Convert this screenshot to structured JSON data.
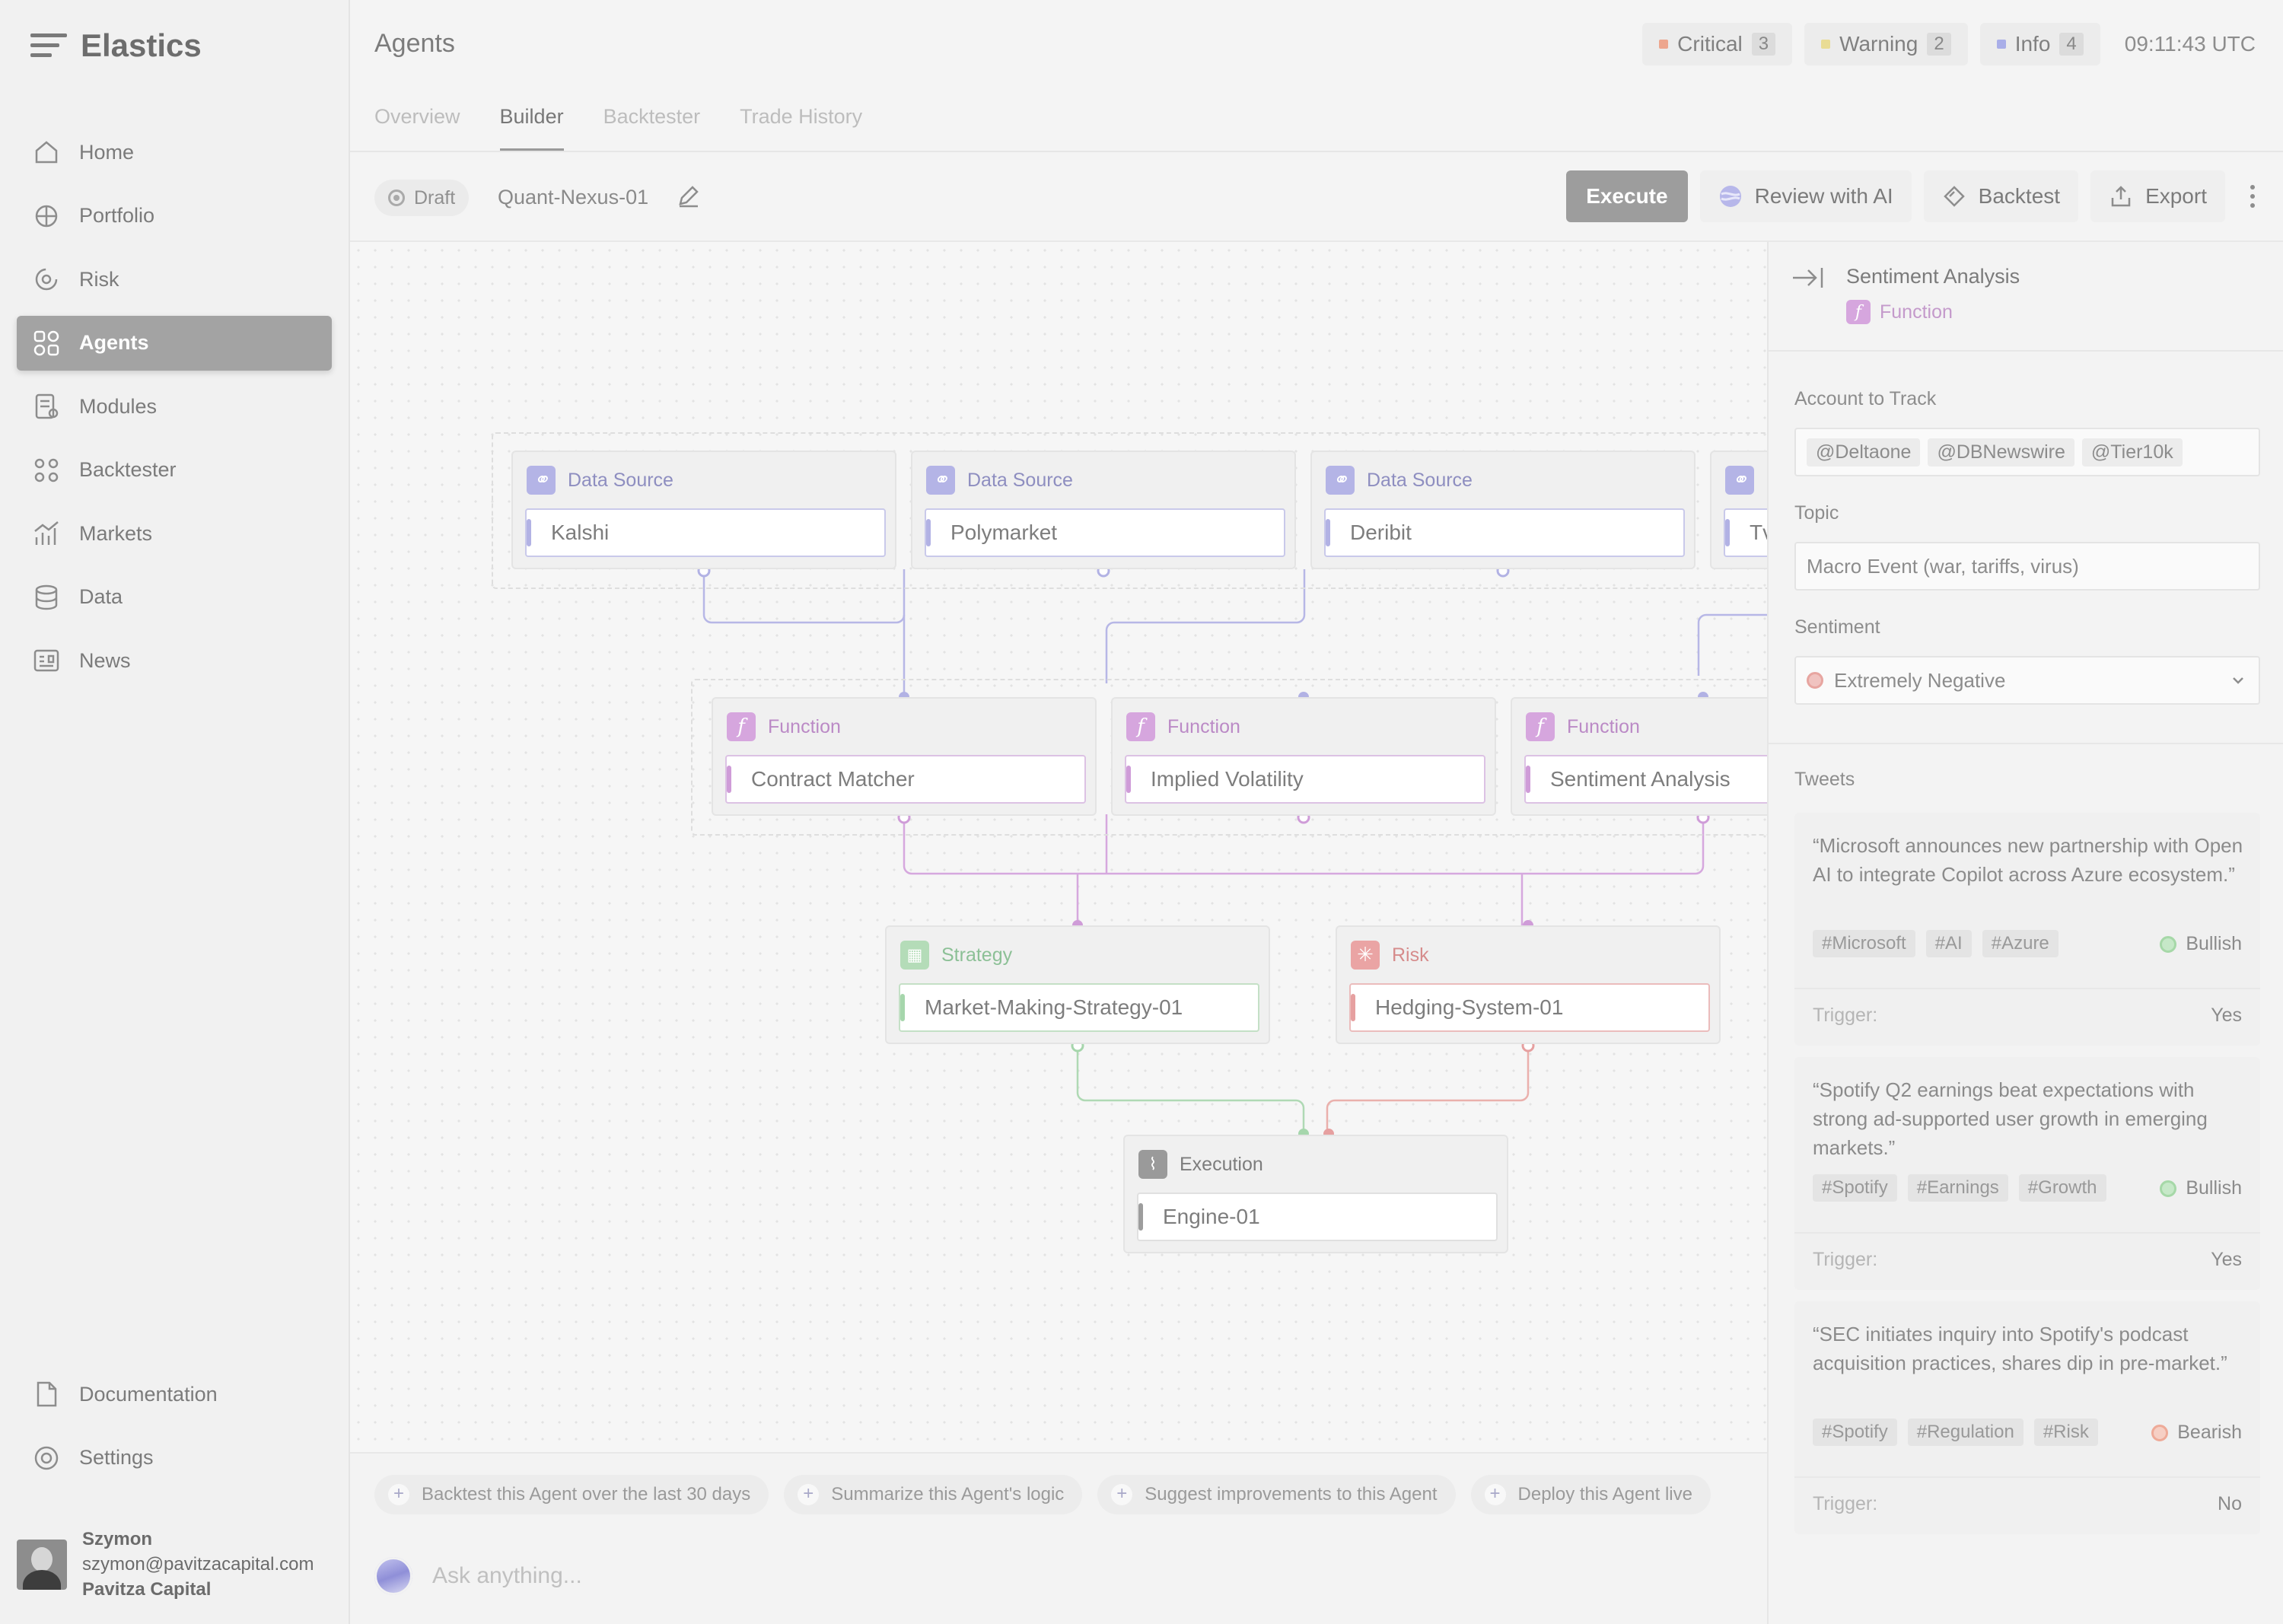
{
  "app": {
    "title": "Elastics"
  },
  "sidebar": {
    "items": [
      {
        "label": "Home",
        "icon": "home-icon"
      },
      {
        "label": "Portfolio",
        "icon": "portfolio-icon"
      },
      {
        "label": "Risk",
        "icon": "risk-icon"
      },
      {
        "label": "Agents",
        "icon": "agents-icon",
        "active": true
      },
      {
        "label": "Modules",
        "icon": "modules-icon"
      },
      {
        "label": "Backtester",
        "icon": "backtester-icon"
      },
      {
        "label": "Markets",
        "icon": "markets-icon"
      },
      {
        "label": "Data",
        "icon": "data-icon"
      },
      {
        "label": "News",
        "icon": "news-icon"
      }
    ],
    "bottom": [
      {
        "label": "Documentation",
        "icon": "documentation-icon"
      },
      {
        "label": "Settings",
        "icon": "settings-icon"
      }
    ],
    "user": {
      "name": "Szymon",
      "email": "szymon@pavitzacapital.com",
      "org": "Pavitza Capital"
    }
  },
  "header": {
    "title": "Agents",
    "tabs": [
      {
        "label": "Overview"
      },
      {
        "label": "Builder",
        "active": true
      },
      {
        "label": "Backtester"
      },
      {
        "label": "Trade History"
      }
    ],
    "alerts": [
      {
        "label": "Critical",
        "count": "3",
        "color": "#eda68e"
      },
      {
        "label": "Warning",
        "count": "2",
        "color": "#e9dc94"
      },
      {
        "label": "Info",
        "count": "4",
        "color": "#a9aee8"
      }
    ],
    "time": "09:11:43 UTC"
  },
  "toolbar": {
    "status": "Draft",
    "agent_name": "Quant-Nexus-01",
    "execute": "Execute",
    "review": "Review with AI",
    "backtest": "Backtest",
    "export": "Export"
  },
  "canvas": {
    "nodes": {
      "ds1": {
        "type": "Data Source",
        "value": "Kalshi"
      },
      "ds2": {
        "type": "Data Source",
        "value": "Polymarket"
      },
      "ds3": {
        "type": "Data Source",
        "value": "Deribit"
      },
      "ds4": {
        "type": "",
        "value": "Tv"
      },
      "fn1": {
        "type": "Function",
        "value": "Contract Matcher"
      },
      "fn2": {
        "type": "Function",
        "value": "Implied Volatility"
      },
      "fn3": {
        "type": "Function",
        "value": "Sentiment Analysis"
      },
      "strategy": {
        "type": "Strategy",
        "value": "Market-Making-Strategy-01"
      },
      "risk": {
        "type": "Risk",
        "value": "Hedging-System-01"
      },
      "execution": {
        "type": "Execution",
        "value": "Engine-01"
      }
    },
    "colors": {
      "data_source": "#b2b2e4",
      "function": "#cf9cd8",
      "strategy": "#a6d6ac",
      "risk": "#e6a0a0",
      "execution": "#9d9d9d"
    }
  },
  "suggestions": [
    "Backtest this Agent over the last 30 days",
    "Summarize this Agent's logic",
    "Suggest improvements to this Agent",
    "Deploy this Agent live"
  ],
  "ask_placeholder": "Ask anything...",
  "panel": {
    "title": "Sentiment Analysis",
    "subtitle": "Function",
    "account_label": "Account to Track",
    "accounts": [
      "@Deltaone",
      "@DBNewswire",
      "@Tier10k"
    ],
    "topic_label": "Topic",
    "topic_value": "Macro Event (war, tariffs, virus)",
    "sentiment_label": "Sentiment",
    "sentiment_value": "Extremely Negative",
    "tweets_label": "Tweets",
    "trigger_label": "Trigger:",
    "tweets": [
      {
        "text": "“Microsoft announces new partnership with Open AI to integrate Copilot across Azure ecosystem.”",
        "tags": [
          "#Microsoft",
          "#AI",
          "#Azure"
        ],
        "sentiment": "Bullish",
        "sentiment_color": "#a6d8a8",
        "trigger": "Yes"
      },
      {
        "text": "“Spotify Q2 earnings beat expectations with strong ad-supported user growth in emerging markets.”",
        "tags": [
          "#Spotify",
          "#Earnings",
          "#Growth"
        ],
        "sentiment": "Bullish",
        "sentiment_color": "#a6d8a8",
        "trigger": "Yes"
      },
      {
        "text": "“SEC initiates inquiry into Spotify's podcast acquisition practices, shares dip in pre-market.”",
        "tags": [
          "#Spotify",
          "#Regulation",
          "#Risk"
        ],
        "sentiment": "Bearish",
        "sentiment_color": "#eeaa98",
        "trigger": "No"
      }
    ]
  }
}
